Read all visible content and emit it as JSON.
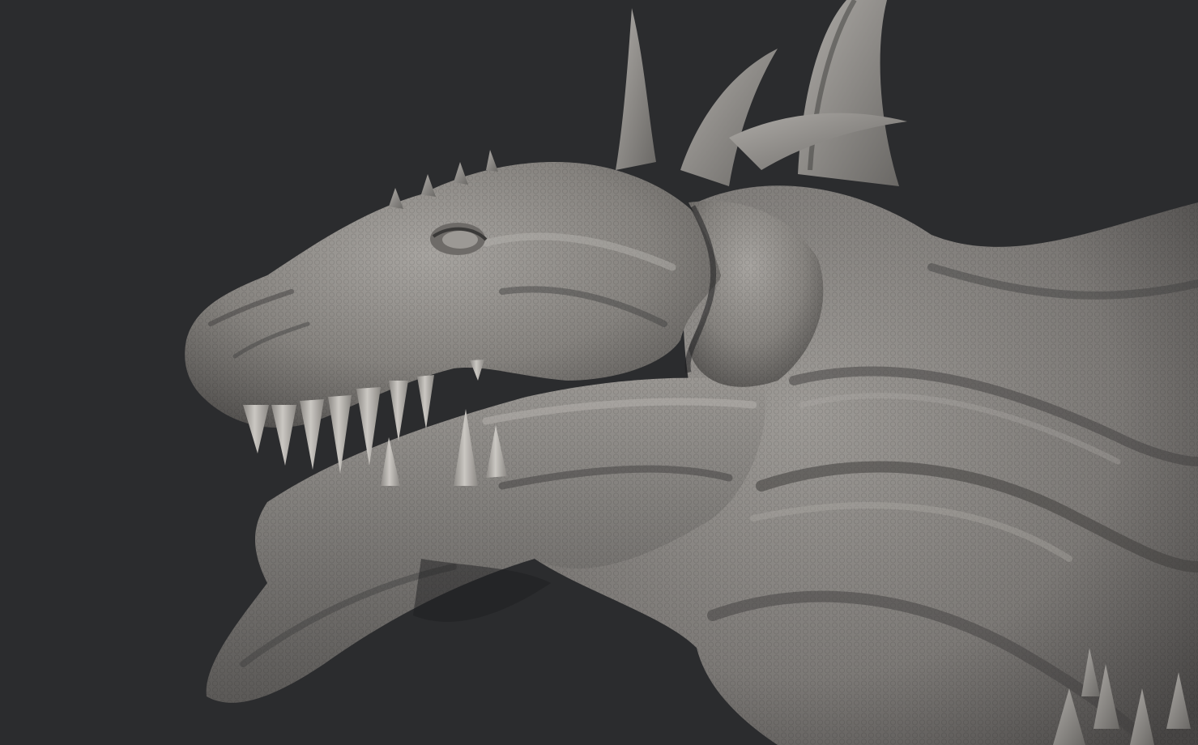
{
  "scene": {
    "subject": "dragon-head-sculpt",
    "colors": {
      "background": "#2b2c2e",
      "clay_light": "#a09d99",
      "clay_mid": "#7f7c79",
      "clay_dark": "#4a4847",
      "shadow": "#1e1e1f",
      "tooth": "#c4c1bc"
    }
  }
}
